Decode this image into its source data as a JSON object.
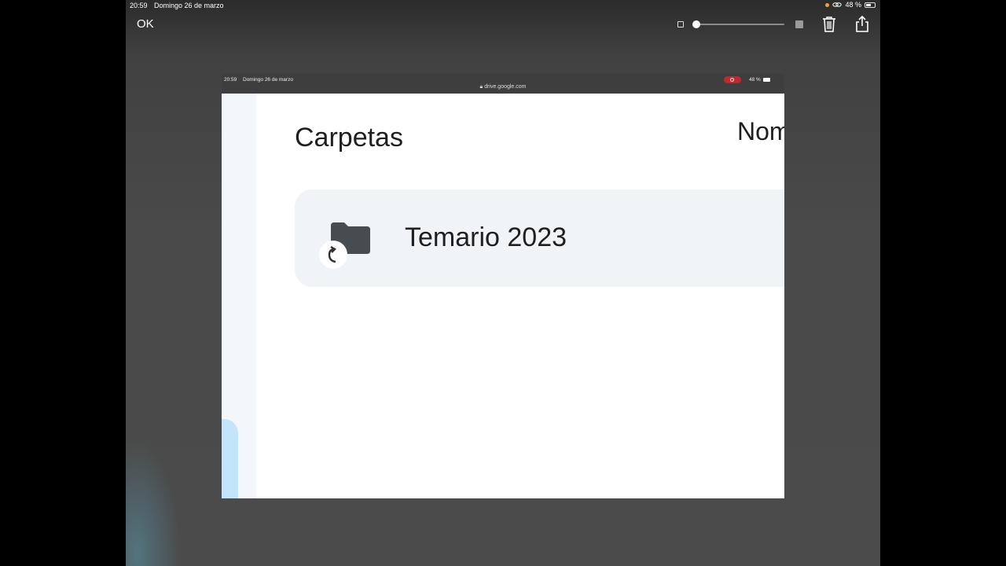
{
  "device_status": {
    "time": "20:59",
    "date": "Domingo 26 de marzo",
    "battery": "48 %"
  },
  "editor": {
    "ok_label": "OK",
    "trash_icon": "trash-icon",
    "share_icon": "share-icon"
  },
  "inner_screenshot": {
    "time": "20:59",
    "date": "Domingo 26 de marzo",
    "url": "drive.google.com",
    "battery": "48 %"
  },
  "drive": {
    "section_title": "Carpetas",
    "sort_header": "Nom",
    "folders": [
      {
        "name": "Temario 2023",
        "icon": "folder-shortcut-icon"
      }
    ]
  },
  "colors": {
    "card_bg": "#f0f4f9",
    "rail_bg": "#f3f7fc",
    "rail_accent": "#c2e5fb",
    "record_red": "#c0282d"
  }
}
